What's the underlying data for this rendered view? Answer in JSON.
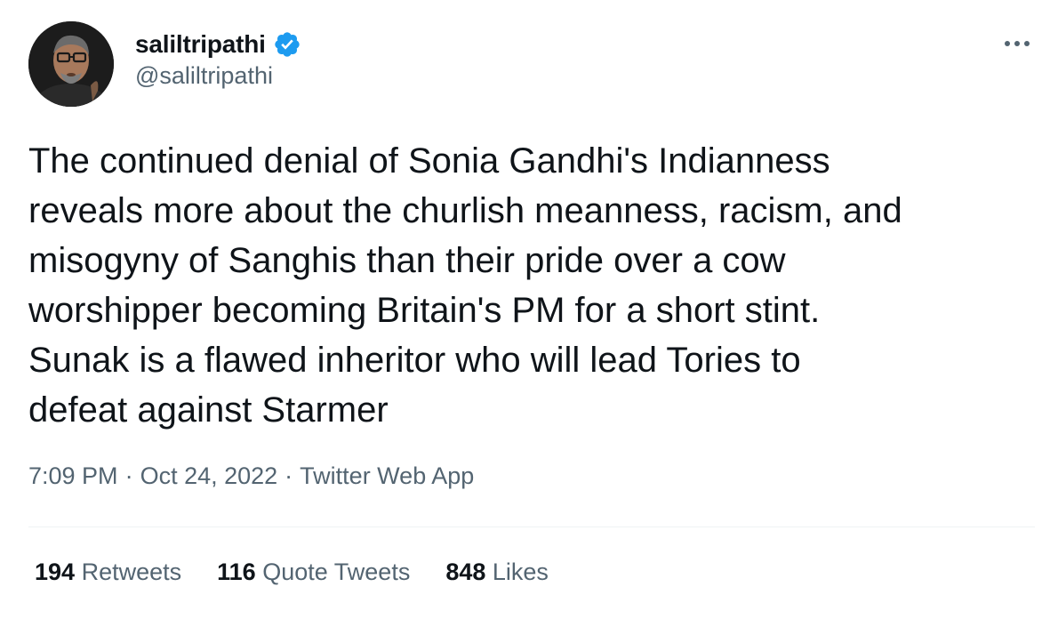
{
  "author": {
    "display_name": "saliltripathi",
    "handle": "@saliltripathi",
    "verified": true,
    "verified_color": "#1d9bf0"
  },
  "tweet": {
    "text_lines": [
      "The continued denial of Sonia Gandhi's Indianness",
      "reveals more about the churlish meanness, racism, and",
      "misogyny of Sanghis than their pride over a cow",
      "worshipper becoming Britain's PM for a short stint.",
      "Sunak is a flawed inheritor who will lead Tories to",
      "defeat against Starmer"
    ],
    "time": "7:09 PM",
    "date": "Oct 24, 2022",
    "separator": "·",
    "source": "Twitter Web App"
  },
  "stats": {
    "retweets_count": "194",
    "retweets_label": "Retweets",
    "quotes_count": "116",
    "quotes_label": "Quote Tweets",
    "likes_count": "848",
    "likes_label": "Likes"
  },
  "icons": {
    "more": "more-horizontal-icon",
    "verified": "verified-badge-icon"
  },
  "colors": {
    "text_primary": "#0f1419",
    "text_secondary": "#536471",
    "divider": "#eff3f4"
  }
}
